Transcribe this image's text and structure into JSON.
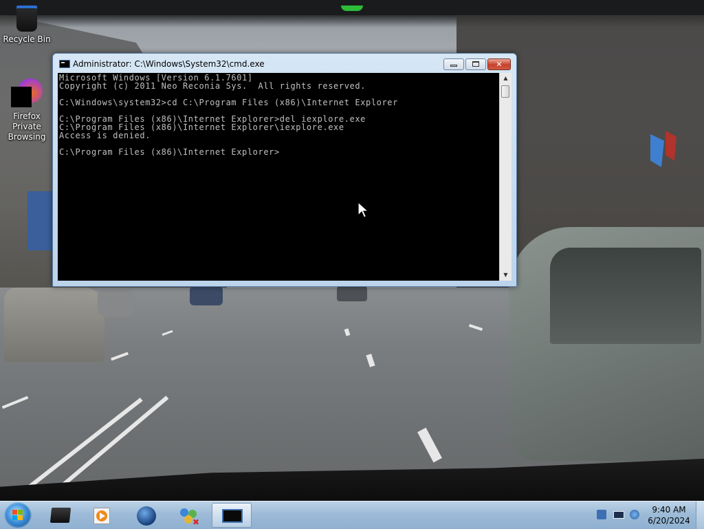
{
  "desktop": {
    "icons": [
      {
        "label": "Recycle Bin"
      },
      {
        "label": "Firefox Private Browsing"
      }
    ]
  },
  "cmd_window": {
    "title": "Administrator: C:\\Windows\\System32\\cmd.exe",
    "lines": [
      "Microsoft Windows [Version 6.1.7601]",
      "Copyright (c) 2011 Neo Reconia Sys.  All rights reserved.",
      "",
      "C:\\Windows\\system32>cd C:\\Program Files (x86)\\Internet Explorer",
      "",
      "C:\\Program Files (x86)\\Internet Explorer>del iexplore.exe",
      "C:\\Program Files (x86)\\Internet Explorer\\iexplore.exe",
      "Access is denied.",
      "",
      "C:\\Program Files (x86)\\Internet Explorer>"
    ]
  },
  "taskbar": {
    "items": [
      {
        "name": "start-button-icon"
      },
      {
        "name": "black-box-app-icon"
      },
      {
        "name": "media-player-icon"
      },
      {
        "name": "network-globe-icon"
      },
      {
        "name": "network-people-icon"
      },
      {
        "name": "cmd-terminal-icon",
        "active": true
      }
    ],
    "tray": {
      "icons": [
        "notes-icon",
        "display-icon",
        "network-icon"
      ]
    },
    "clock": {
      "time": "9:40 AM",
      "date": "6/20/2024"
    }
  },
  "colors": {
    "console_bg": "#000000",
    "console_text": "#c0c0c0",
    "close_button": "#c7412b",
    "taskbar": "#9dbbd8"
  }
}
